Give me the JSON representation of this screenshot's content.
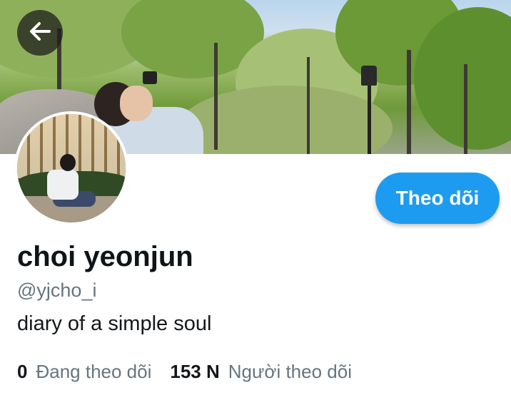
{
  "header": {
    "back_icon": "arrow-left-icon"
  },
  "profile": {
    "name": "choi yeonjun",
    "handle": "@yjcho_i",
    "bio": "diary of a simple soul",
    "follow_label": "Theo dõi",
    "stats": {
      "following_count": "0",
      "following_label": "Đang theo dõi",
      "followers_count": "153 N",
      "followers_label": "Người theo dõi"
    }
  },
  "colors": {
    "accent": "#1d9bf0",
    "text_primary": "#0f1419",
    "text_secondary": "#66757f"
  }
}
